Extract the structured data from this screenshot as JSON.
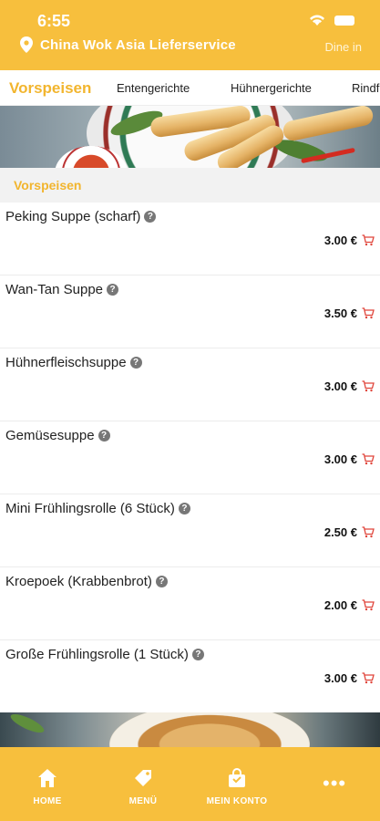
{
  "status_bar": {
    "time": "6:55"
  },
  "header": {
    "restaurant_name": "China Wok Asia Lieferservice",
    "dine_in_label": "Dine in"
  },
  "tabs": [
    {
      "label": "Vorspeisen",
      "active": true
    },
    {
      "label": "Entengerichte",
      "active": false
    },
    {
      "label": "Hühnergerichte",
      "active": false
    },
    {
      "label": "Rindf",
      "active": false
    }
  ],
  "section": {
    "title": "Vorspeisen"
  },
  "currency": "€",
  "items": [
    {
      "name": "Peking Suppe (scharf)",
      "price": "3.00 €"
    },
    {
      "name": "Wan-Tan Suppe",
      "price": "3.50 €"
    },
    {
      "name": "Hühnerfleischsuppe",
      "price": "3.00 €"
    },
    {
      "name": "Gemüsesuppe",
      "price": "3.00 €"
    },
    {
      "name": "Mini Frühlingsrolle (6 Stück)",
      "price": "2.50 €"
    },
    {
      "name": "Kroepoek (Krabbenbrot)",
      "price": "2.00 €"
    },
    {
      "name": "Große Frühlingsrolle (1 Stück)",
      "price": "3.00 €"
    }
  ],
  "bottom_nav": [
    {
      "label": "HOME",
      "icon": "home-icon"
    },
    {
      "label": "MENÜ",
      "icon": "tag-icon"
    },
    {
      "label": "MEIN KONTO",
      "icon": "bag-icon"
    },
    {
      "label": "",
      "icon": "more-icon"
    }
  ],
  "colors": {
    "brand_yellow": "#f7bf3d",
    "accent_text": "#f2b52e",
    "cart_red": "#e0443a"
  }
}
